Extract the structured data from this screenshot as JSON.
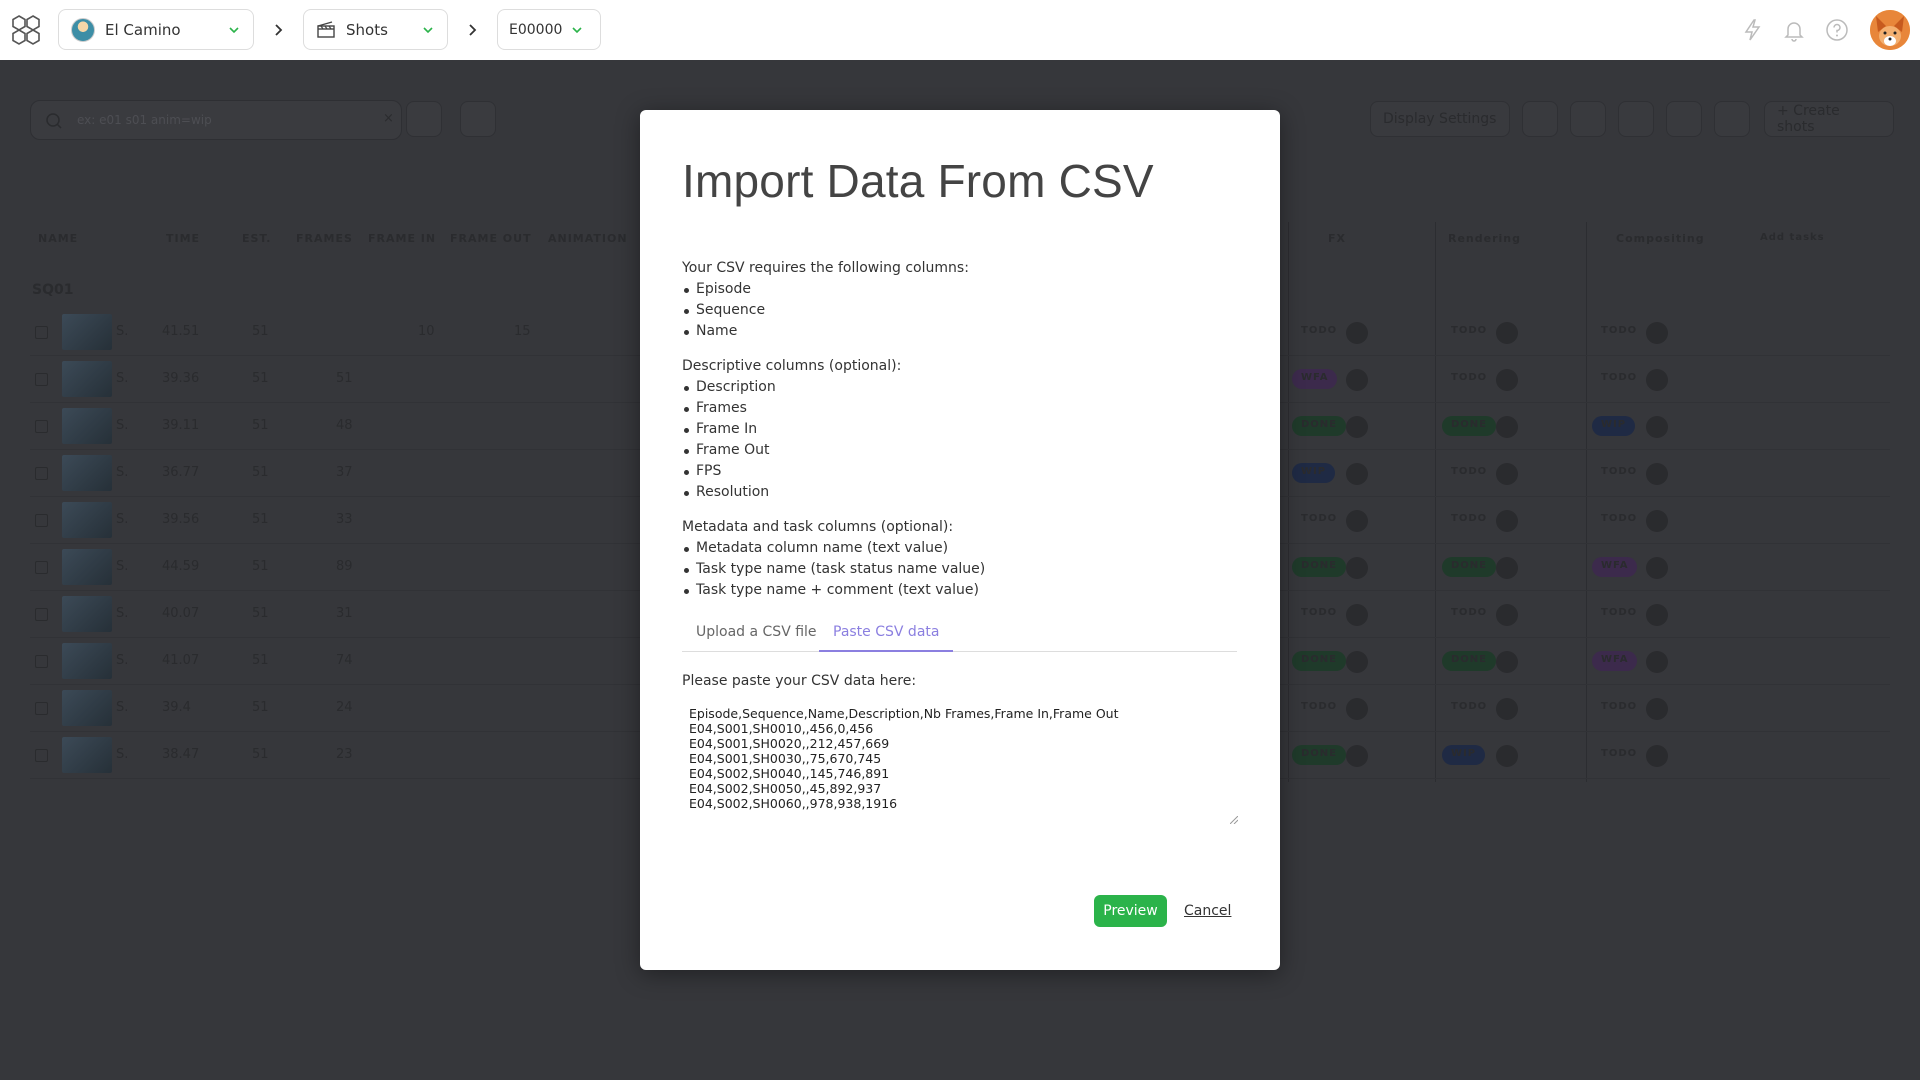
{
  "topbar": {
    "production": "El Camino",
    "section": "Shots",
    "episode": "E00000"
  },
  "background": {
    "search_placeholder": "ex: e01 s01 anim=wip",
    "display_settings": "Display Settings",
    "create_shots": "+ Create shots",
    "columns": [
      "NAME",
      "TIME",
      "EST.",
      "FRAMES",
      "FRAME IN",
      "FRAME OUT",
      "ANIMATION",
      "FX",
      "Rendering",
      "Compositing"
    ],
    "add_tasks": "Add tasks",
    "sequence": "SQ01",
    "rows": [
      {
        "name": "S.",
        "time": "41.51",
        "est": "51",
        "frames": "",
        "in": "10",
        "out": "15",
        "fx": "TODO",
        "render": "TODO",
        "comp": "TODO"
      },
      {
        "name": "S.",
        "time": "39.36",
        "est": "51",
        "frames": "51",
        "in": "",
        "out": "",
        "fx": "WFA",
        "render": "TODO",
        "comp": "TODO"
      },
      {
        "name": "S.",
        "time": "39.11",
        "est": "51",
        "frames": "48",
        "in": "",
        "out": "",
        "fx": "DONE",
        "render": "DONE",
        "comp": "WIP"
      },
      {
        "name": "S.",
        "time": "36.77",
        "est": "51",
        "frames": "37",
        "in": "",
        "out": "",
        "fx": "WIP",
        "render": "TODO",
        "comp": "TODO"
      },
      {
        "name": "S.",
        "time": "39.56",
        "est": "51",
        "frames": "33",
        "in": "",
        "out": "",
        "fx": "TODO",
        "render": "TODO",
        "comp": "TODO"
      },
      {
        "name": "S.",
        "time": "44.59",
        "est": "51",
        "frames": "89",
        "in": "",
        "out": "",
        "fx": "DONE",
        "render": "DONE",
        "comp": "WFA"
      },
      {
        "name": "S.",
        "time": "40.07",
        "est": "51",
        "frames": "31",
        "in": "",
        "out": "",
        "fx": "TODO",
        "render": "TODO",
        "comp": "TODO"
      },
      {
        "name": "S.",
        "time": "41.07",
        "est": "51",
        "frames": "74",
        "in": "",
        "out": "",
        "fx": "DONE",
        "render": "DONE",
        "comp": "WFA"
      },
      {
        "name": "S.",
        "time": "39.4",
        "est": "51",
        "frames": "24",
        "in": "",
        "out": "",
        "fx": "TODO",
        "render": "TODO",
        "comp": "TODO"
      },
      {
        "name": "S.",
        "time": "38.47",
        "est": "51",
        "frames": "23",
        "in": "",
        "out": "",
        "fx": "DONE",
        "render": "WIP",
        "comp": "TODO"
      }
    ]
  },
  "modal": {
    "title": "Import Data From CSV",
    "required_heading": "Your CSV requires the following columns:",
    "required": [
      "Episode",
      "Sequence",
      "Name"
    ],
    "descriptive_heading": "Descriptive columns (optional):",
    "descriptive": [
      "Description",
      "Frames",
      "Frame In",
      "Frame Out",
      "FPS",
      "Resolution"
    ],
    "metadata_heading": "Metadata and task columns (optional):",
    "metadata": [
      "Metadata column name (text value)",
      "Task type name (task status name value)",
      "Task type name + comment (text value)"
    ],
    "tabs": [
      "Upload a CSV file",
      "Paste CSV data"
    ],
    "active_tab": "Paste CSV data",
    "paste_label": "Please paste your CSV data here:",
    "csv_text": "Episode,Sequence,Name,Description,Nb Frames,Frame In,Frame Out\nE04,S001,SH0010,,456,0,456\nE04,S001,SH0020,,212,457,669\nE04,S001,SH0030,,75,670,745\nE04,S002,SH0040,,145,746,891\nE04,S002,SH0050,,45,892,937\nE04,S002,SH0060,,978,938,1916",
    "preview_label": "Preview",
    "cancel_label": "Cancel"
  },
  "colors": {
    "accent": "#8b7fe0",
    "primary_button": "#2bb34a",
    "overlay": "#36373b"
  }
}
